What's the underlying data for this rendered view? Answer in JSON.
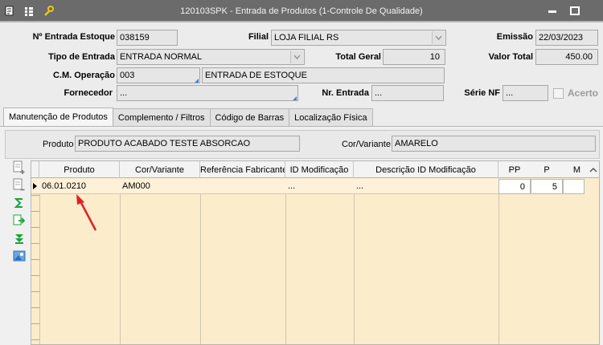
{
  "window": {
    "title": "120103SPK - Entrada de Produtos (1-Controle De Qualidade)"
  },
  "header": {
    "entrada_label": "Nº Entrada Estoque",
    "entrada_value": "038159",
    "filial_label": "Filial",
    "filial_value": "LOJA FILIAL RS",
    "emissao_label": "Emissão",
    "emissao_value": "22/03/2023",
    "tipo_label": "Tipo de Entrada",
    "tipo_value": "ENTRADA NORMAL",
    "total_geral_label": "Total Geral",
    "total_geral_value": "10",
    "valor_total_label": "Valor Total",
    "valor_total_value": "450.00",
    "cm_operacao_label": "C.M. Operação",
    "cm_operacao_code": "003",
    "cm_operacao_desc": "ENTRADA DE ESTOQUE",
    "fornecedor_label": "Fornecedor",
    "fornecedor_value": "...",
    "nr_entrada_label": "Nr. Entrada",
    "nr_entrada_value": "...",
    "serie_nf_label": "Série NF",
    "serie_nf_value": "...",
    "acerto_label": "Acerto"
  },
  "tabs": [
    {
      "label": "Manutenção de Produtos",
      "active": true
    },
    {
      "label": "Complemento / Filtros",
      "active": false
    },
    {
      "label": "Código de Barras",
      "active": false
    },
    {
      "label": "Localização Física",
      "active": false
    }
  ],
  "product_strip": {
    "produto_label": "Produto",
    "produto_value": "PRODUTO ACABADO TESTE ABSORCAO",
    "cor_label": "Cor/Variante",
    "cor_value": "AMARELO"
  },
  "grid": {
    "columns": [
      "Produto",
      "Cor/Variante",
      "Referência Fabricante",
      "ID Modificação",
      "Descrição ID Modificação",
      "PP",
      "P",
      "M"
    ],
    "rows": [
      {
        "produto": "06.01.0210",
        "cor": "AM000",
        "ref": "",
        "id_mod": "...",
        "desc_mod": "...",
        "pp": "0",
        "p": "5",
        "m": ""
      }
    ]
  },
  "colors": {
    "titlebar": "#6b6b6b",
    "grid_bg": "#fbeccb",
    "annotation_arrow": "#e02020"
  },
  "icons": [
    "toolbar-doc-icon",
    "toolbar-list-icon",
    "toolbar-wrench-icon",
    "minimize-icon",
    "maximize-icon",
    "add-row-icon",
    "delete-row-icon",
    "sum-icon",
    "export-icon",
    "download-icon",
    "image-icon",
    "dropdown-arrow-icon",
    "lookup-icon",
    "scroll-up-icon",
    "row-indicator-icon"
  ]
}
